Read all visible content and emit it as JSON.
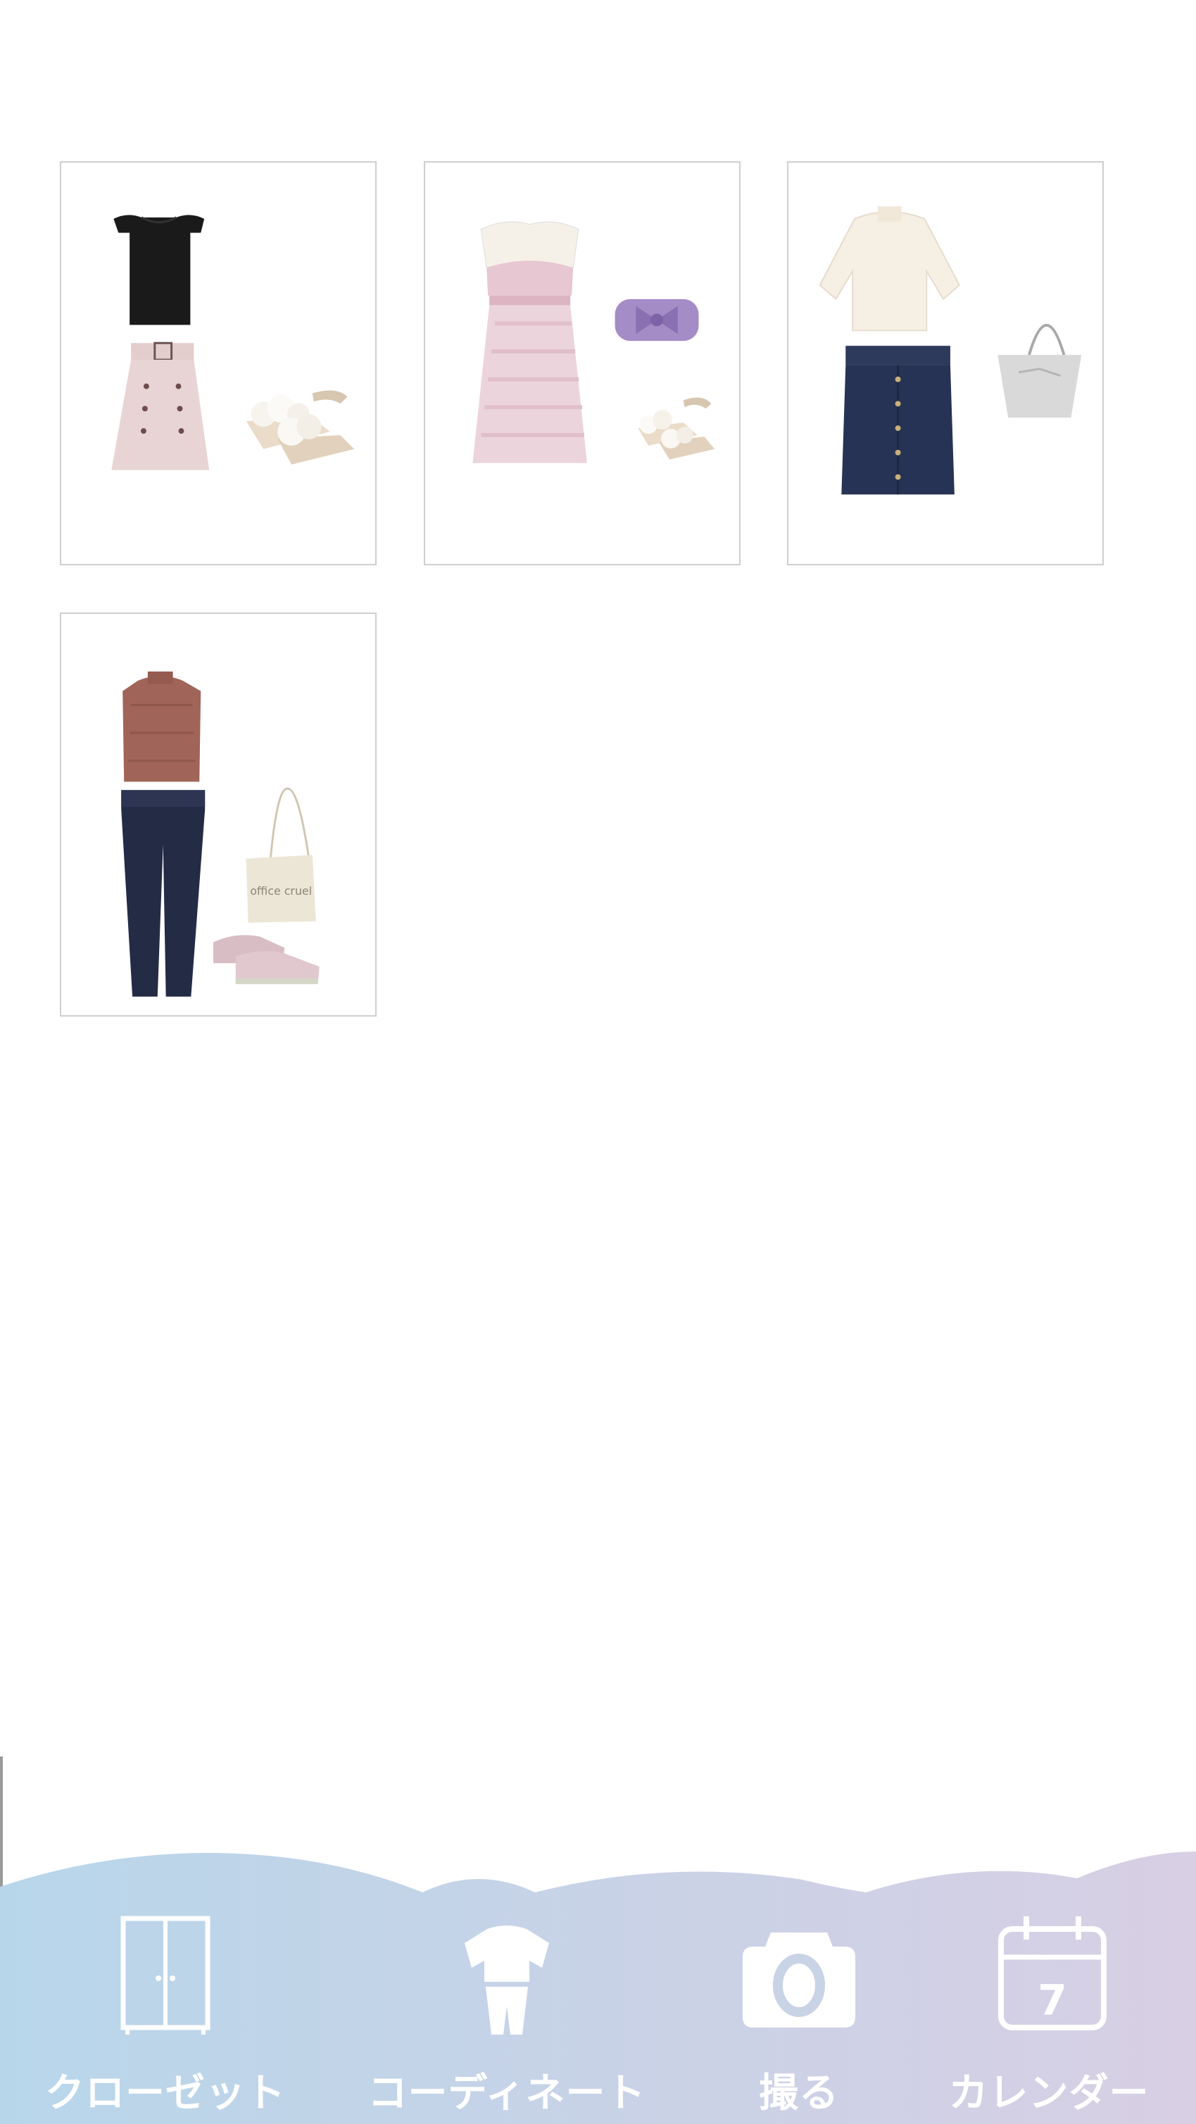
{
  "outfits": [
    {
      "items": [
        "black-ruffle-top",
        "pink-belted-skirt",
        "cream-pompom-sandals"
      ]
    },
    {
      "items": [
        "pink-tweed-dress",
        "lavender-bow-pouch",
        "cream-pompom-sandals"
      ]
    },
    {
      "items": [
        "cream-lace-blouse",
        "navy-denim-skirt",
        "grey-tote-bag"
      ]
    },
    {
      "items": [
        "rose-knit-top",
        "navy-tapered-pants",
        "canvas-tote-bag",
        "pink-sneakers"
      ]
    }
  ],
  "tote_print": "office cruel",
  "bottom_nav": {
    "colors": {
      "gradient_start": "#b8d6ea",
      "gradient_end": "#d8cfe4"
    },
    "tabs": [
      {
        "label": "クローゼット",
        "icon": "wardrobe-icon"
      },
      {
        "label": "コーディネート",
        "icon": "outfit-icon"
      },
      {
        "label": "撮る",
        "icon": "camera-icon"
      },
      {
        "label": "カレンダー",
        "icon": "calendar-icon"
      }
    ],
    "calendar_day": "7"
  }
}
